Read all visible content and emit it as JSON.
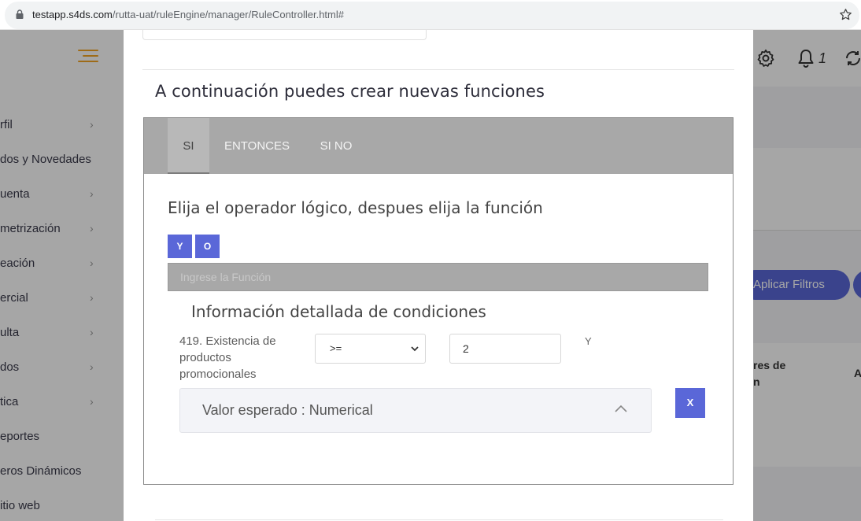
{
  "browser": {
    "url_host": "testapp.s4ds.com",
    "url_path": "/rutta-uat/ruleEngine/manager/RuleController.html#"
  },
  "header": {
    "notification_count": "1"
  },
  "sidebar": {
    "items": [
      {
        "label": "rfil",
        "has_chevron": true
      },
      {
        "label": "dos y Novedades",
        "has_chevron": false
      },
      {
        "label": "uenta",
        "has_chevron": true
      },
      {
        "label": "metrización",
        "has_chevron": true
      },
      {
        "label": "eación",
        "has_chevron": true
      },
      {
        "label": "ercial",
        "has_chevron": true
      },
      {
        "label": "ulta",
        "has_chevron": true
      },
      {
        "label": "dos",
        "has_chevron": true
      },
      {
        "label": "tica",
        "has_chevron": true
      },
      {
        "label": "eportes",
        "has_chevron": false
      },
      {
        "label": "eros Dinámicos",
        "has_chevron": false
      },
      {
        "label": "itio web",
        "has_chevron": false
      }
    ]
  },
  "background": {
    "filter_button": "Aplicar Filtros",
    "table_header_1": "res de\nn",
    "table_header_2": "A"
  },
  "modal": {
    "section_title": "A continuación puedes crear nuevas funciones",
    "tabs": [
      {
        "label": "SI",
        "active": true
      },
      {
        "label": "ENTONCES",
        "active": false
      },
      {
        "label": "SI NO",
        "active": false
      }
    ],
    "heading": "Elija el operador lógico, despues elija la función",
    "operators": [
      "Y",
      "O"
    ],
    "function_input": {
      "placeholder": "Ingrese la Función",
      "value": ""
    },
    "detail_heading": "Información detallada de condiciones",
    "condition": {
      "name": "419. Existencia de productos promocionales",
      "operator": ">=",
      "value": "2",
      "logic": "Y",
      "expected": "Valor esperado : Numerical",
      "remove_label": "X"
    }
  },
  "colors": {
    "accent": "#5a67d8",
    "hamburger": "#f3a526",
    "tabbar": "#a8a8a8"
  }
}
